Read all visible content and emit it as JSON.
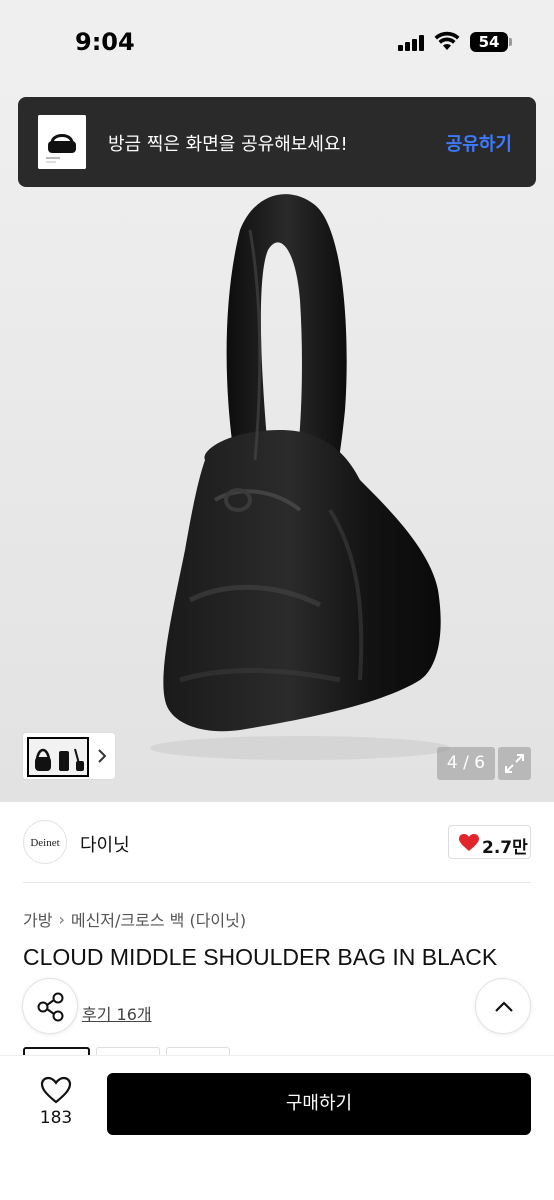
{
  "status_bar": {
    "time": "9:04",
    "battery": "54"
  },
  "share_banner": {
    "message": "방금 찍은 화면을 공유해보세요!",
    "action": "공유하기"
  },
  "gallery": {
    "counter": "4 / 6"
  },
  "brand": {
    "logo_text": "Deinet",
    "name": "다이닛",
    "likes": "2.7만"
  },
  "breadcrumb": [
    "가방",
    "메신저/크로스 백 (다이닛)"
  ],
  "product": {
    "title": "CLOUD MIDDLE SHOULDER BAG IN BLACK",
    "review_link": "후기 16개"
  },
  "bottom_bar": {
    "wish_count": "183",
    "buy_label": "구매하기"
  },
  "icons": [
    "signal-icon",
    "wifi-icon",
    "chevron-right-icon",
    "expand-icon",
    "heart-filled-icon",
    "share-icon",
    "chevron-up-icon",
    "heart-outline-icon"
  ],
  "colors": {
    "banner_bg": "#2a2a2a",
    "banner_action": "#3c7bff",
    "like_heart": "#e0262c",
    "buy_button": "#000000"
  }
}
